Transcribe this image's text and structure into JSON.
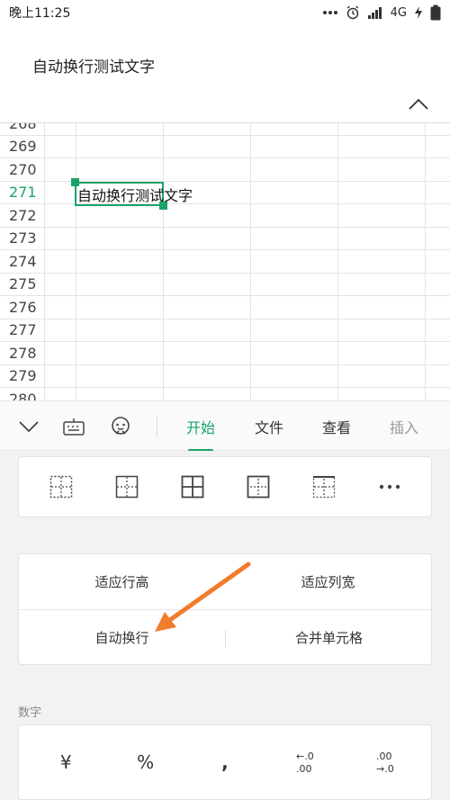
{
  "status": {
    "time": "晚上11:25",
    "network": "4G"
  },
  "formula": {
    "content": "自动换行测试文字"
  },
  "sheet": {
    "rows": [
      {
        "num": "268",
        "active": false
      },
      {
        "num": "269",
        "active": false
      },
      {
        "num": "270",
        "active": false
      },
      {
        "num": "271",
        "active": true
      },
      {
        "num": "272",
        "active": false
      },
      {
        "num": "273",
        "active": false
      },
      {
        "num": "274",
        "active": false
      },
      {
        "num": "275",
        "active": false
      },
      {
        "num": "276",
        "active": false
      },
      {
        "num": "277",
        "active": false
      },
      {
        "num": "278",
        "active": false
      },
      {
        "num": "279",
        "active": false
      },
      {
        "num": "280",
        "active": false
      }
    ],
    "active_cell_text": "自动换行测试文字"
  },
  "toolbar": {
    "tabs": [
      {
        "label": "开始",
        "active": true
      },
      {
        "label": "文件",
        "active": false
      },
      {
        "label": "查看",
        "active": false
      },
      {
        "label": "插入",
        "active": false
      }
    ]
  },
  "cells_panel": {
    "fit_row_height": "适应行高",
    "fit_col_width": "适应列宽",
    "wrap_text": "自动换行",
    "merge_cells": "合并单元格"
  },
  "number_section": {
    "label": "数字",
    "currency": "¥",
    "percent": "%",
    "comma": ",",
    "decrease_decimal": "←.0\n.00",
    "increase_decimal": ".00\n→.0"
  },
  "colors": {
    "accent": "#1aa368",
    "arrow": "#f07d2c"
  }
}
